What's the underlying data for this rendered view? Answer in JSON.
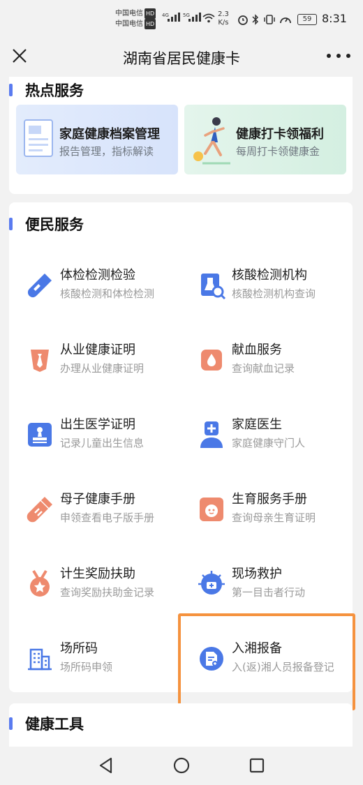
{
  "status_bar": {
    "carrier_1": "中国电信",
    "carrier_2": "中国电信",
    "hd_badge": "HD",
    "net_1": "4G",
    "net_2": "5G",
    "speed_value": "2.3",
    "speed_unit": "K/s",
    "battery": "59",
    "time": "8:31"
  },
  "title_bar": {
    "title": "湖南省居民健康卡"
  },
  "hot_services": {
    "title": "热点服务",
    "items": [
      {
        "title": "家庭健康档案管理",
        "subtitle": "报告管理，指标解读"
      },
      {
        "title": "健康打卡领福利",
        "subtitle": "每周打卡领健康金"
      }
    ]
  },
  "convenience": {
    "title": "便民服务",
    "items": [
      {
        "name": "体检检测检验",
        "desc": "核酸检测和体检检测",
        "icon": "test-tube-icon"
      },
      {
        "name": "核酸检测机构",
        "desc": "核酸检测机构查询",
        "icon": "lab-search-icon"
      },
      {
        "name": "从业健康证明",
        "desc": "办理从业健康证明",
        "icon": "tie-certificate-icon"
      },
      {
        "name": "献血服务",
        "desc": "查询献血记录",
        "icon": "blood-drop-icon"
      },
      {
        "name": "出生医学证明",
        "desc": "记录儿童出生信息",
        "icon": "stamp-icon"
      },
      {
        "name": "家庭医生",
        "desc": "家庭健康守门人",
        "icon": "doctor-icon"
      },
      {
        "name": "母子健康手册",
        "desc": "申领查看电子版手册",
        "icon": "baby-bottle-icon"
      },
      {
        "name": "生育服务手册",
        "desc": "查询母亲生育证明",
        "icon": "baby-face-icon"
      },
      {
        "name": "计生奖励扶助",
        "desc": "查询奖励扶助金记录",
        "icon": "medal-icon"
      },
      {
        "name": "现场救护",
        "desc": "第一目击者行动",
        "icon": "rescue-icon"
      },
      {
        "name": "场所码",
        "desc": "场所码申领",
        "icon": "building-icon"
      },
      {
        "name": "入湘报备",
        "desc": "入(返)湘人员报备登记",
        "icon": "report-document-icon"
      }
    ]
  },
  "health_tools": {
    "title": "健康工具"
  },
  "colors": {
    "accent": "#5a7bf0",
    "highlight_border": "#f5923e",
    "icon_blue": "#4a78e6",
    "icon_coral": "#ee8a6e"
  }
}
